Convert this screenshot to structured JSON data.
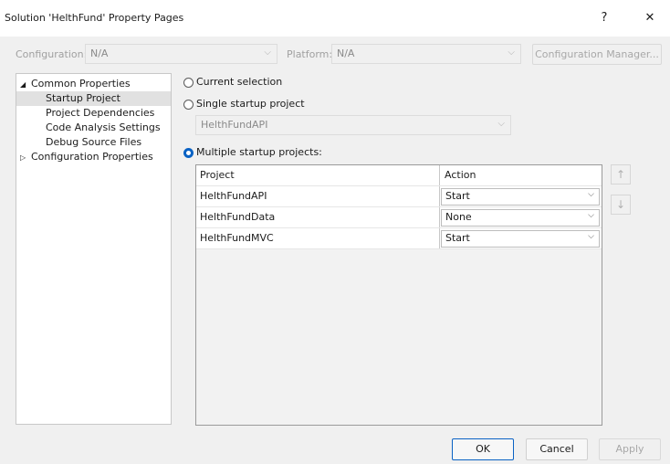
{
  "window": {
    "title": "Solution 'HelthFund' Property Pages",
    "help_glyph": "?",
    "close_glyph": "✕"
  },
  "config_row": {
    "configuration_label": "Configuration:",
    "configuration_value": "N/A",
    "platform_label": "Platform:",
    "platform_value": "N/A",
    "manager_button": "Configuration Manager..."
  },
  "tree": {
    "items": [
      {
        "label": "Common Properties",
        "expander": "◢",
        "selected": false
      },
      {
        "label": "Startup Project",
        "selected": true
      },
      {
        "label": "Project Dependencies",
        "selected": false
      },
      {
        "label": "Code Analysis Settings",
        "selected": false
      },
      {
        "label": "Debug Source Files",
        "selected": false
      },
      {
        "label": "Configuration Properties",
        "expander": "▷",
        "selected": false
      }
    ]
  },
  "startup": {
    "current_selection": "Current selection",
    "single_project": "Single startup project",
    "single_value": "HelthFundAPI",
    "multiple_projects": "Multiple startup projects:",
    "selected_option": "multiple"
  },
  "grid": {
    "headers": [
      "Project",
      "Action"
    ],
    "rows": [
      {
        "project": "HelthFundAPI",
        "action": "Start"
      },
      {
        "project": "HelthFundData",
        "action": "None"
      },
      {
        "project": "HelthFundMVC",
        "action": "Start"
      }
    ]
  },
  "move": {
    "up_glyph": "↑",
    "down_glyph": "↓"
  },
  "buttons": {
    "ok": "OK",
    "cancel": "Cancel",
    "apply": "Apply"
  },
  "colors": {
    "accent": "#0a62c4",
    "background": "#f0f0f0"
  }
}
